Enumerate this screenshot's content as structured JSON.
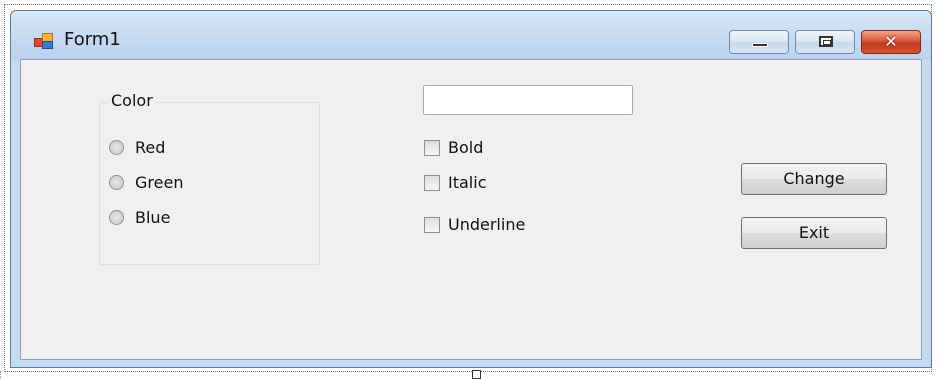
{
  "window": {
    "title": "Form1",
    "icon": "windows-form-icon",
    "caption_buttons": {
      "minimize": "minimize-icon",
      "maximize": "maximize-icon",
      "close_glyph": "✕"
    }
  },
  "color_group": {
    "title": "Color",
    "options": [
      "Red",
      "Green",
      "Blue"
    ]
  },
  "text_input": {
    "value": ""
  },
  "style_checks": [
    "Bold",
    "Italic",
    "Underline"
  ],
  "buttons": {
    "change": "Change",
    "exit": "Exit"
  },
  "colors": {
    "client_bg": "#f0f0f0",
    "frame": "#c5d9ef",
    "close_button": "#c9432a"
  }
}
